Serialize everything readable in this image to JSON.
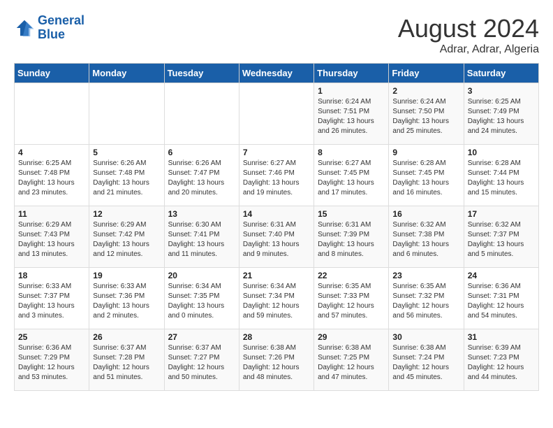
{
  "header": {
    "logo_general": "General",
    "logo_blue": "Blue",
    "month_year": "August 2024",
    "location": "Adrar, Adrar, Algeria"
  },
  "days_of_week": [
    "Sunday",
    "Monday",
    "Tuesday",
    "Wednesday",
    "Thursday",
    "Friday",
    "Saturday"
  ],
  "weeks": [
    [
      {
        "day": "",
        "info": ""
      },
      {
        "day": "",
        "info": ""
      },
      {
        "day": "",
        "info": ""
      },
      {
        "day": "",
        "info": ""
      },
      {
        "day": "1",
        "info": "Sunrise: 6:24 AM\nSunset: 7:51 PM\nDaylight: 13 hours\nand 26 minutes."
      },
      {
        "day": "2",
        "info": "Sunrise: 6:24 AM\nSunset: 7:50 PM\nDaylight: 13 hours\nand 25 minutes."
      },
      {
        "day": "3",
        "info": "Sunrise: 6:25 AM\nSunset: 7:49 PM\nDaylight: 13 hours\nand 24 minutes."
      }
    ],
    [
      {
        "day": "4",
        "info": "Sunrise: 6:25 AM\nSunset: 7:48 PM\nDaylight: 13 hours\nand 23 minutes."
      },
      {
        "day": "5",
        "info": "Sunrise: 6:26 AM\nSunset: 7:48 PM\nDaylight: 13 hours\nand 21 minutes."
      },
      {
        "day": "6",
        "info": "Sunrise: 6:26 AM\nSunset: 7:47 PM\nDaylight: 13 hours\nand 20 minutes."
      },
      {
        "day": "7",
        "info": "Sunrise: 6:27 AM\nSunset: 7:46 PM\nDaylight: 13 hours\nand 19 minutes."
      },
      {
        "day": "8",
        "info": "Sunrise: 6:27 AM\nSunset: 7:45 PM\nDaylight: 13 hours\nand 17 minutes."
      },
      {
        "day": "9",
        "info": "Sunrise: 6:28 AM\nSunset: 7:45 PM\nDaylight: 13 hours\nand 16 minutes."
      },
      {
        "day": "10",
        "info": "Sunrise: 6:28 AM\nSunset: 7:44 PM\nDaylight: 13 hours\nand 15 minutes."
      }
    ],
    [
      {
        "day": "11",
        "info": "Sunrise: 6:29 AM\nSunset: 7:43 PM\nDaylight: 13 hours\nand 13 minutes."
      },
      {
        "day": "12",
        "info": "Sunrise: 6:29 AM\nSunset: 7:42 PM\nDaylight: 13 hours\nand 12 minutes."
      },
      {
        "day": "13",
        "info": "Sunrise: 6:30 AM\nSunset: 7:41 PM\nDaylight: 13 hours\nand 11 minutes."
      },
      {
        "day": "14",
        "info": "Sunrise: 6:31 AM\nSunset: 7:40 PM\nDaylight: 13 hours\nand 9 minutes."
      },
      {
        "day": "15",
        "info": "Sunrise: 6:31 AM\nSunset: 7:39 PM\nDaylight: 13 hours\nand 8 minutes."
      },
      {
        "day": "16",
        "info": "Sunrise: 6:32 AM\nSunset: 7:38 PM\nDaylight: 13 hours\nand 6 minutes."
      },
      {
        "day": "17",
        "info": "Sunrise: 6:32 AM\nSunset: 7:37 PM\nDaylight: 13 hours\nand 5 minutes."
      }
    ],
    [
      {
        "day": "18",
        "info": "Sunrise: 6:33 AM\nSunset: 7:37 PM\nDaylight: 13 hours\nand 3 minutes."
      },
      {
        "day": "19",
        "info": "Sunrise: 6:33 AM\nSunset: 7:36 PM\nDaylight: 13 hours\nand 2 minutes."
      },
      {
        "day": "20",
        "info": "Sunrise: 6:34 AM\nSunset: 7:35 PM\nDaylight: 13 hours\nand 0 minutes."
      },
      {
        "day": "21",
        "info": "Sunrise: 6:34 AM\nSunset: 7:34 PM\nDaylight: 12 hours\nand 59 minutes."
      },
      {
        "day": "22",
        "info": "Sunrise: 6:35 AM\nSunset: 7:33 PM\nDaylight: 12 hours\nand 57 minutes."
      },
      {
        "day": "23",
        "info": "Sunrise: 6:35 AM\nSunset: 7:32 PM\nDaylight: 12 hours\nand 56 minutes."
      },
      {
        "day": "24",
        "info": "Sunrise: 6:36 AM\nSunset: 7:31 PM\nDaylight: 12 hours\nand 54 minutes."
      }
    ],
    [
      {
        "day": "25",
        "info": "Sunrise: 6:36 AM\nSunset: 7:29 PM\nDaylight: 12 hours\nand 53 minutes."
      },
      {
        "day": "26",
        "info": "Sunrise: 6:37 AM\nSunset: 7:28 PM\nDaylight: 12 hours\nand 51 minutes."
      },
      {
        "day": "27",
        "info": "Sunrise: 6:37 AM\nSunset: 7:27 PM\nDaylight: 12 hours\nand 50 minutes."
      },
      {
        "day": "28",
        "info": "Sunrise: 6:38 AM\nSunset: 7:26 PM\nDaylight: 12 hours\nand 48 minutes."
      },
      {
        "day": "29",
        "info": "Sunrise: 6:38 AM\nSunset: 7:25 PM\nDaylight: 12 hours\nand 47 minutes."
      },
      {
        "day": "30",
        "info": "Sunrise: 6:38 AM\nSunset: 7:24 PM\nDaylight: 12 hours\nand 45 minutes."
      },
      {
        "day": "31",
        "info": "Sunrise: 6:39 AM\nSunset: 7:23 PM\nDaylight: 12 hours\nand 44 minutes."
      }
    ]
  ]
}
